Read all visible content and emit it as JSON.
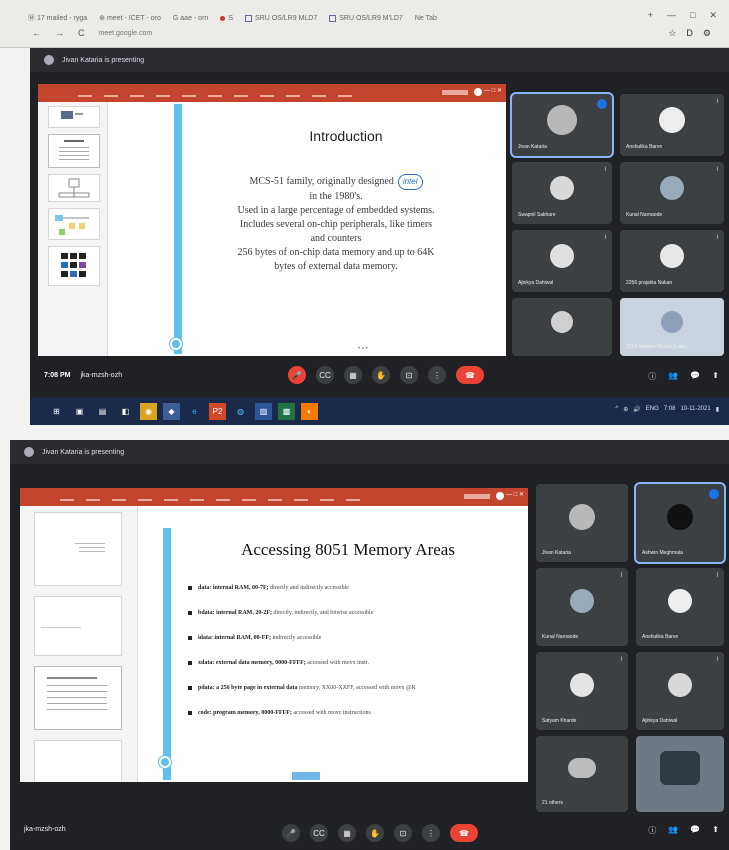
{
  "browser": {
    "tabs": [
      "Ⓜ 17 mailed - ryga",
      "⊕ meet - ICET - oro",
      "G aae - orn",
      "S",
      "SRU OS/LR9 MLD7",
      "SRU OS/LR9 M'LD7",
      "Ne Tab"
    ],
    "tab_end": [
      "+",
      "—",
      "□",
      "✕"
    ],
    "nav": [
      "←",
      "→",
      "C"
    ],
    "url": "meet.google.com",
    "nav_right": [
      "☆",
      "D",
      "⚙"
    ]
  },
  "meet1": {
    "presenting": "Jivan Kataria is presenting",
    "slide_title": "Introduction",
    "slide_lines": [
      "MCS-51 family, originally designed",
      "in the 1980's.",
      "Used in a large percentage of embedded systems.",
      "Includes several on-chip peripherals, like timers",
      "and counters",
      "256 bytes of on-chip data memory and up to 64K",
      "bytes of external data memory."
    ],
    "intel_logo": "intel",
    "time": "7:08 PM",
    "meeting_code": "jka-mzsh-ozh",
    "participants": [
      {
        "name": "Jivan Kataria",
        "active": true
      },
      {
        "name": "Anshulika Barve",
        "active": false
      },
      {
        "name": "Swapnil Sakhare",
        "active": false
      },
      {
        "name": "Kunal Narnaode",
        "active": false
      },
      {
        "name": "Ajinkya Dahiwal",
        "active": false
      },
      {
        "name": "2256 prajakta Nakan",
        "active": false
      },
      {
        "name": "",
        "active": false
      },
      {
        "name": "2258 Moolkin Mulani (Lake)",
        "active": false
      }
    ],
    "taskbar_tray": [
      "^",
      "⊕",
      "🔊",
      "ENG",
      "7:08",
      "10-11-2021",
      "▮"
    ]
  },
  "meet2": {
    "presenting": "Jivan Kataria is presenting",
    "slide_title": "Accessing 8051 Memory Areas",
    "bullets": [
      {
        "head": "data: internal RAM, 00-7F;",
        "rest": "directly and indirectly accessible"
      },
      {
        "head": "bdata: internal RAM, 20-2F;",
        "rest": "directly, indirectly, and bitwise accessible"
      },
      {
        "head": "idata: internal RAM, 00-FF;",
        "rest": "indirectly accessible"
      },
      {
        "head": "xdata: external data memory, 0000-FFFF;",
        "rest": "accessed with movx instr."
      },
      {
        "head": "pdata: a 256 byte page in external data",
        "rest": "memory, XX00-XXFF, accessed with movx @R"
      },
      {
        "head": "code: program memory, 0000-FFFF;",
        "rest": "accessed with movc instructions"
      }
    ],
    "meeting_code": "jka-mzsh-ozh",
    "participants": [
      {
        "name": "Jivan Kataria",
        "active": false
      },
      {
        "name": "Ashwin Meghmala",
        "active": true
      },
      {
        "name": "Kunal Narnaode",
        "active": false
      },
      {
        "name": "Anshulika Barve",
        "active": false
      },
      {
        "name": "Satyam Kharde",
        "active": false
      },
      {
        "name": "Ajinkya Dahiwal",
        "active": false
      },
      {
        "name": "21 others",
        "active": false
      },
      {
        "name": "",
        "active": false
      }
    ]
  },
  "controls": {
    "mic": "🎤",
    "cc": "CC",
    "cam": "▦",
    "hand": "✋",
    "present": "⊡",
    "more": "⋮",
    "end": "☎",
    "info": "ⓘ",
    "people": "👥",
    "chat": "💬",
    "activities": "⬆"
  },
  "taskbar_icons": [
    "⊞",
    "▣",
    "▤",
    "◧",
    "◉",
    "◆",
    "e",
    "P2",
    "◍",
    "▨",
    "▩",
    "◐"
  ],
  "colors": {
    "ppt": "#c4452e",
    "meet_bg": "#202124",
    "accent": "#5ec0ec",
    "end": "#ea4335"
  }
}
